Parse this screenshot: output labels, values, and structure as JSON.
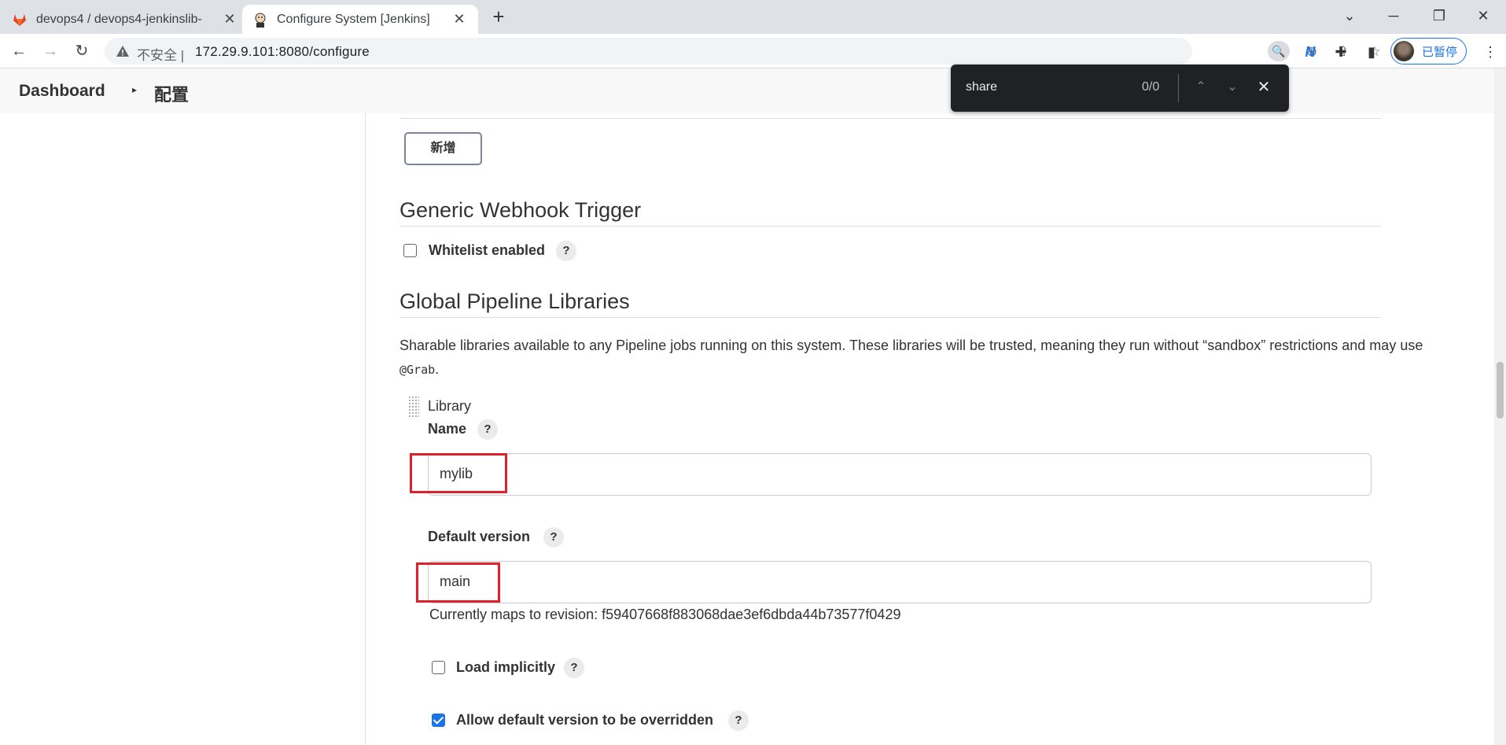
{
  "browser": {
    "tabs": [
      {
        "label": "devops4 / devops4-jenkinslib-",
        "icon": "gitlab-icon"
      },
      {
        "label": "Configure System [Jenkins]",
        "icon": "jenkins-icon"
      }
    ],
    "address": {
      "security_label": "不安全",
      "separator": "|",
      "url": "172.29.9.101:8080/configure"
    },
    "profile": {
      "label": "已暂停"
    }
  },
  "breadcrumb": {
    "dashboard": "Dashboard",
    "separator": "▸",
    "current": "配置"
  },
  "find_bar": {
    "query": "share",
    "count": "0/0"
  },
  "content": {
    "add_button": "新增",
    "webhook": {
      "heading": "Generic Webhook Trigger",
      "whitelist_label": "Whitelist enabled",
      "whitelist_checked": false
    },
    "pipeline_libs": {
      "heading": "Global Pipeline Libraries",
      "description": "Sharable libraries available to any Pipeline jobs running on this system. These libraries will be trusted, meaning they run without “sandbox” restrictions and may use ",
      "description_code": "@Grab",
      "description_end": ".",
      "library_title": "Library",
      "name_label": "Name",
      "name_value": "mylib",
      "version_label": "Default version",
      "version_value": "main",
      "revision_text": "Currently maps to revision: f59407668f883068dae3ef6dbda44b73577f0429",
      "load_implicitly_label": "Load implicitly",
      "load_implicitly_checked": false,
      "allow_override_label": "Allow default version to be overridden",
      "allow_override_checked": true
    },
    "help_glyph": "?"
  },
  "colors": {
    "highlight_box": "#e0202a",
    "accent": "#1a73e8"
  }
}
